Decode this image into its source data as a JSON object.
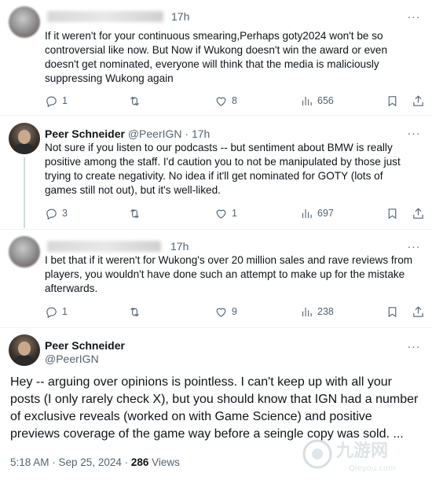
{
  "tweets": [
    {
      "time": "17h",
      "text": "If it weren't for your continuous smearing,Perhaps goty2024 won't be so controversial like now. But Now if Wukong doesn't win the award or even doesn't get nominated, everyone will think that the media is maliciously suppressing Wukong again",
      "replies": "1",
      "retweets": "",
      "likes": "8",
      "views": "656"
    },
    {
      "name": "Peer Schneider",
      "handle": "@PeerIGN",
      "separator": "·",
      "time": "17h",
      "text": "Not sure if you listen to our podcasts -- but sentiment about BMW is really positive among the staff. I'd caution you to not be manipulated by those just trying to create negativity. No idea if it'll get nominated for GOTY (lots of games still not out), but it's well-liked.",
      "replies": "3",
      "retweets": "",
      "likes": "1",
      "views": "697"
    },
    {
      "time": "17h",
      "text": "I bet that if it weren't for Wukong's over 20 million sales and rave reviews from players, you wouldn't have done such an attempt to make up for the mistake afterwards.",
      "replies": "1",
      "retweets": "",
      "likes": "9",
      "views": "238"
    }
  ],
  "main_tweet": {
    "name": "Peer Schneider",
    "handle": "@PeerIGN",
    "text": "Hey -- arguing over opinions is pointless. I can't keep up with all your posts (I only rarely check X), but you should know that IGN had a number of exclusive reveals (worked on with Game Science) and positive previews coverage of the game way before a seingle copy was sold. ...",
    "timestamp": "5:18 AM · Sep 25, 2024 · ",
    "views_count": "286",
    "views_label": " Views"
  },
  "more_label": "···",
  "watermark": {
    "text": "九游网",
    "subtext": "Qleyou.com"
  },
  "colors": {
    "text": "#0f1419",
    "secondary": "#536471",
    "divider": "#eff3f4",
    "thread": "#cfd9de"
  }
}
